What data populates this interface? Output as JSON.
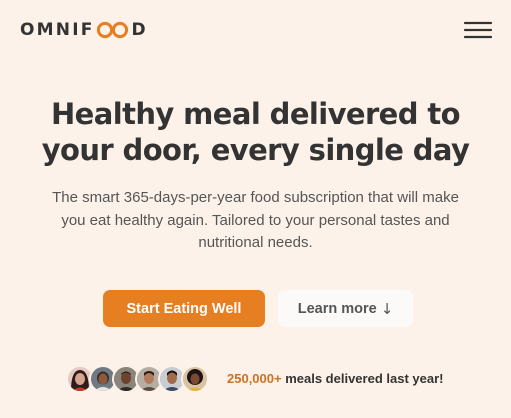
{
  "header": {
    "logo": {
      "text_before": "OMNIF",
      "text_after": "D",
      "rings_icon": "infinity-rings-icon",
      "accent_color": "#e67e22"
    },
    "menu_icon": "hamburger-menu-icon"
  },
  "hero": {
    "title_line1": "Healthy meal delivered to",
    "title_line2": "your door, every single day",
    "description_line1": "The smart 365-days-per-year food subscription that will make",
    "description_line2": "you eat healthy again. Tailored to your personal tastes and",
    "description_line3": "nutritional needs.",
    "primary_button": "Start Eating Well",
    "secondary_button": "Learn more",
    "secondary_button_icon": "↓"
  },
  "delivered": {
    "count": "250,000+",
    "text": " meals delivered last year!",
    "customer_avatars": [
      "customer-avatar-1",
      "customer-avatar-2",
      "customer-avatar-3",
      "customer-avatar-4",
      "customer-avatar-5",
      "customer-avatar-6"
    ]
  },
  "colors": {
    "background": "#fdf2e9",
    "primary": "#e67e22",
    "accent_text": "#cf711f",
    "heading": "#333333",
    "body_text": "#555555",
    "secondary_button_bg": "#fbfaf9"
  }
}
